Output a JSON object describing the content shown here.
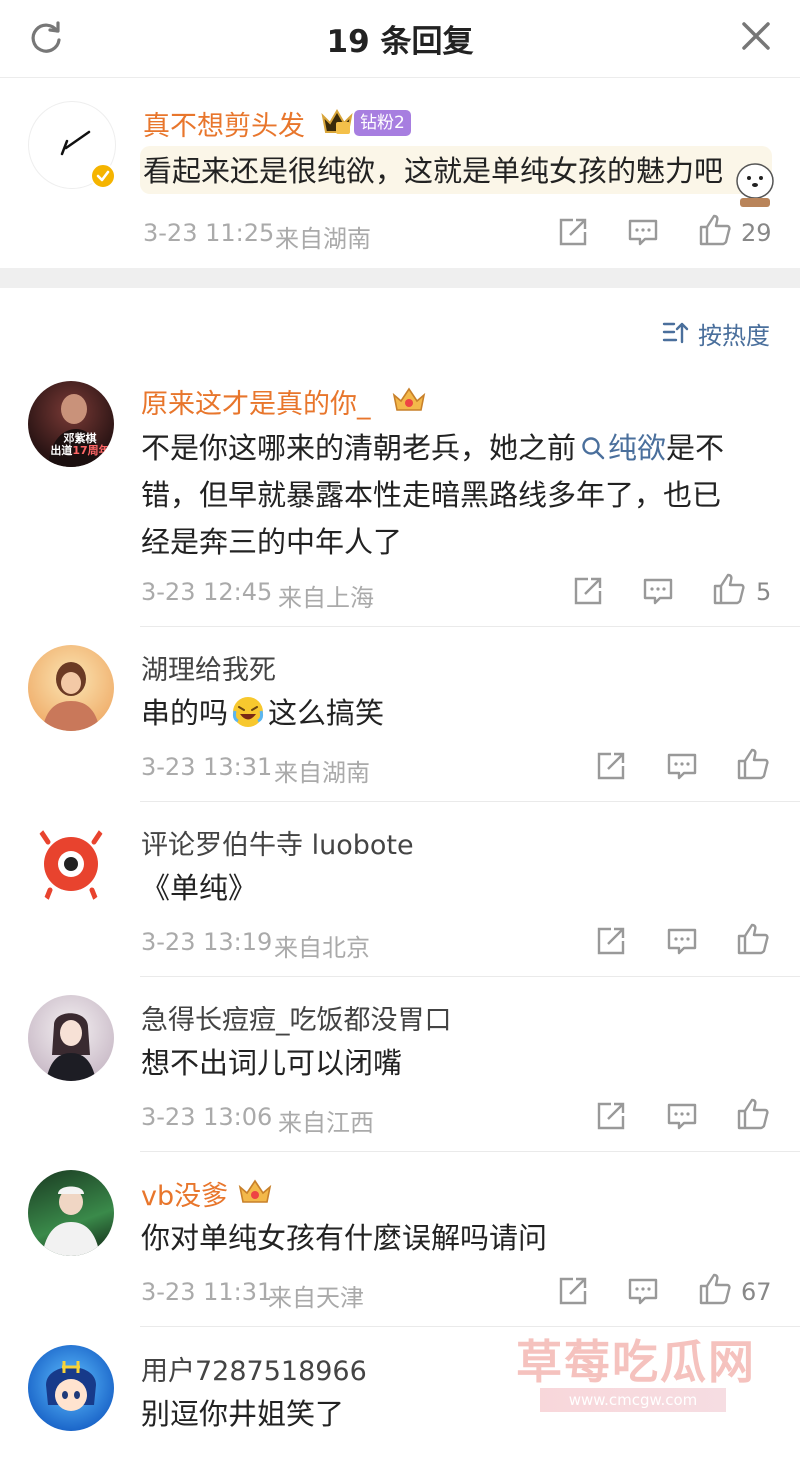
{
  "header": {
    "title": "19 条回复"
  },
  "main_comment": {
    "user": "真不想剪头发",
    "fans_badge": "钻粉2",
    "text": "看起来还是很纯欲，这就是单纯女孩的魅力吧",
    "time": "3-23 11:25",
    "location": "来自湖南",
    "likes": "29"
  },
  "sort": {
    "label": "按热度"
  },
  "replies": [
    {
      "user": "原来这才是真的你_",
      "lines": [
        "不是你这哪来的清朝老兵，她之前",
        "纯欲",
        "是不",
        "错，但早就暴露本性走暗黑路线多年了，也已",
        "经是奔三的中年人了"
      ],
      "avatar_text": [
        "邓紫棋",
        "出道",
        "17周年"
      ],
      "time": "3-23 12:45",
      "location": "来自上海",
      "likes": "5"
    },
    {
      "user": "湖理给我死",
      "text_a": "串的吗",
      "text_b": "这么搞笑",
      "time": "3-23 13:31",
      "location": "来自湖南",
      "likes": ""
    },
    {
      "user": "评论罗伯牛寺 luobote",
      "text": "《单纯》",
      "time": "3-23 13:19",
      "location": "来自北京",
      "likes": ""
    },
    {
      "user": "急得长痘痘_吃饭都没胃口",
      "text": "想不出词儿可以闭嘴",
      "time": "3-23 13:06",
      "location": "来自江西",
      "likes": ""
    },
    {
      "user": "vb没爹",
      "text": "你对单纯女孩有什麼误解吗请问",
      "time": "3-23 11:31",
      "location": "来自天津",
      "likes": "67"
    },
    {
      "user": "用户7287518966",
      "text": "别逗你井姐笑了"
    }
  ],
  "watermark": {
    "text": "草莓吃瓜网",
    "url": "www.cmcgw.com"
  },
  "colors": {
    "username_orange": "#e8762c",
    "link_blue": "#4a6f9c",
    "fans_badge": "#a77ee0",
    "verified": "#f5b400"
  }
}
